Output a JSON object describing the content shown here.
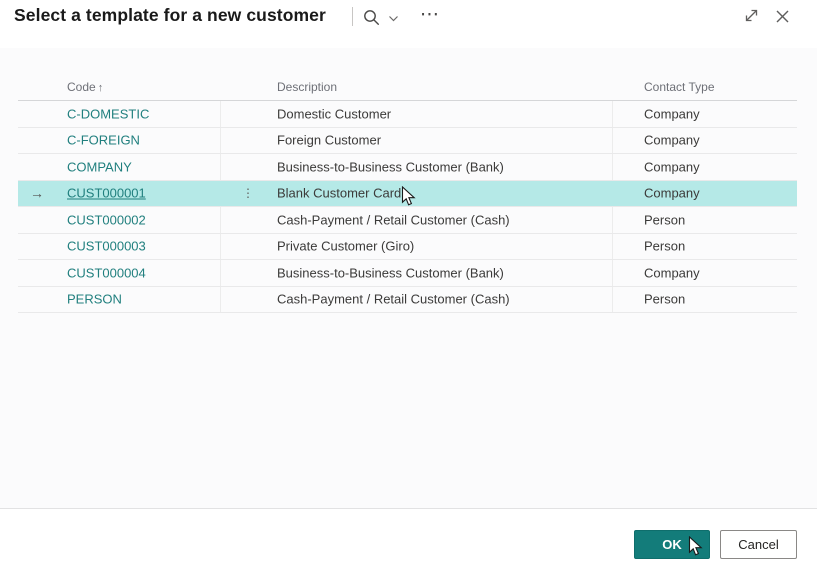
{
  "window": {
    "title": "Select a template for a new customer"
  },
  "icons": {
    "more_options": "⋯",
    "row_arrow": "→",
    "row_menu": "⋮",
    "sort_ascending": "↑"
  },
  "table": {
    "columns": [
      {
        "label": "Code",
        "sort": "ascending"
      },
      {
        "label": "Description"
      },
      {
        "label": "Contact Type"
      }
    ],
    "rows": [
      {
        "code": "C-DOMESTIC",
        "description": "Domestic Customer",
        "contact_type": "Company",
        "selected": false
      },
      {
        "code": "C-FOREIGN",
        "description": "Foreign Customer",
        "contact_type": "Company",
        "selected": false
      },
      {
        "code": "COMPANY",
        "description": "Business-to-Business Customer (Bank)",
        "contact_type": "Company",
        "selected": false
      },
      {
        "code": "CUST000001",
        "description": "Blank Customer Card",
        "contact_type": "Company",
        "selected": true
      },
      {
        "code": "CUST000002",
        "description": "Cash-Payment / Retail Customer (Cash)",
        "contact_type": "Person",
        "selected": false
      },
      {
        "code": "CUST000003",
        "description": "Private Customer (Giro)",
        "contact_type": "Person",
        "selected": false
      },
      {
        "code": "CUST000004",
        "description": "Business-to-Business Customer (Bank)",
        "contact_type": "Company",
        "selected": false
      },
      {
        "code": "PERSON",
        "description": "Cash-Payment / Retail Customer (Cash)",
        "contact_type": "Person",
        "selected": false
      }
    ]
  },
  "footer": {
    "ok_label": "OK",
    "cancel_label": "Cancel"
  },
  "colors": {
    "link": "#207f7e",
    "primary_button": "#137c7a",
    "selected_row": "#b5e9e7"
  }
}
